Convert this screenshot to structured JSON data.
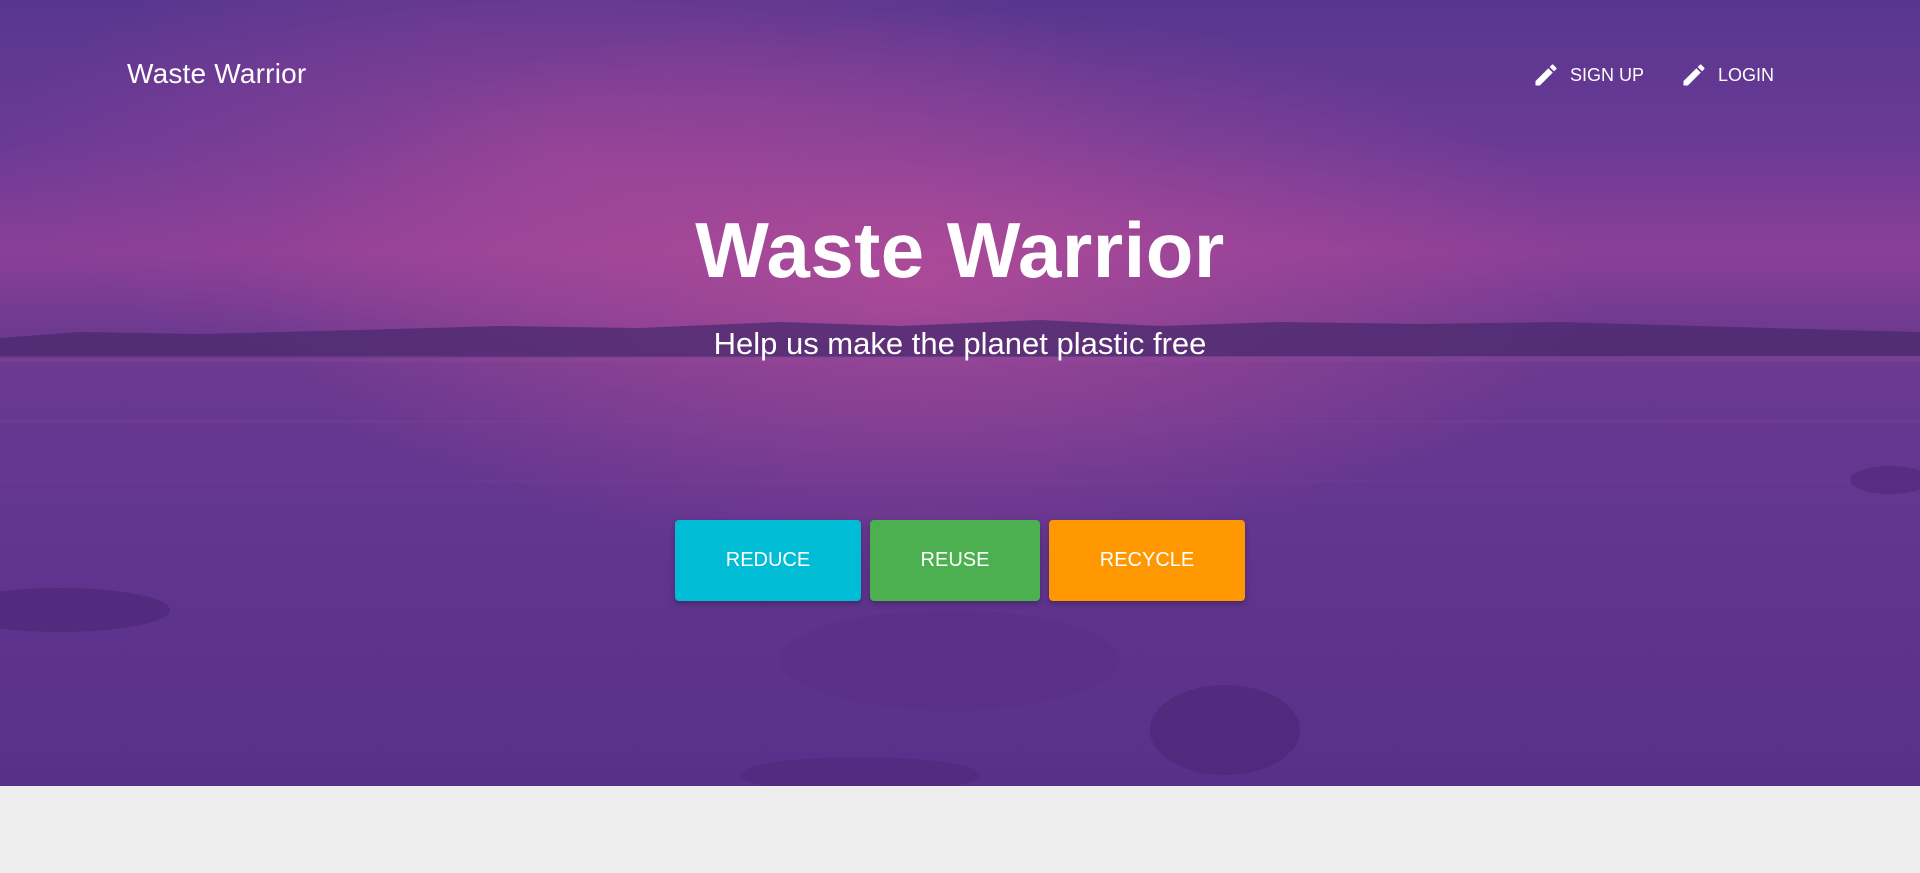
{
  "navbar": {
    "brand": "Waste Warrior",
    "links": [
      {
        "label": "SIGN UP",
        "icon": "pencil-icon"
      },
      {
        "label": "LOGIN",
        "icon": "pencil-icon"
      }
    ]
  },
  "hero": {
    "title": "Waste Warrior",
    "subtitle": "Help us make the planet plastic free",
    "overlay_color": "#5a2f8c",
    "buttons": [
      {
        "label": "REDUCE",
        "color": "#00bcd4"
      },
      {
        "label": "REUSE",
        "color": "#4caf50"
      },
      {
        "label": "RECYCLE",
        "color": "#ff9800"
      }
    ]
  },
  "page": {
    "background_color": "#eeeded"
  }
}
